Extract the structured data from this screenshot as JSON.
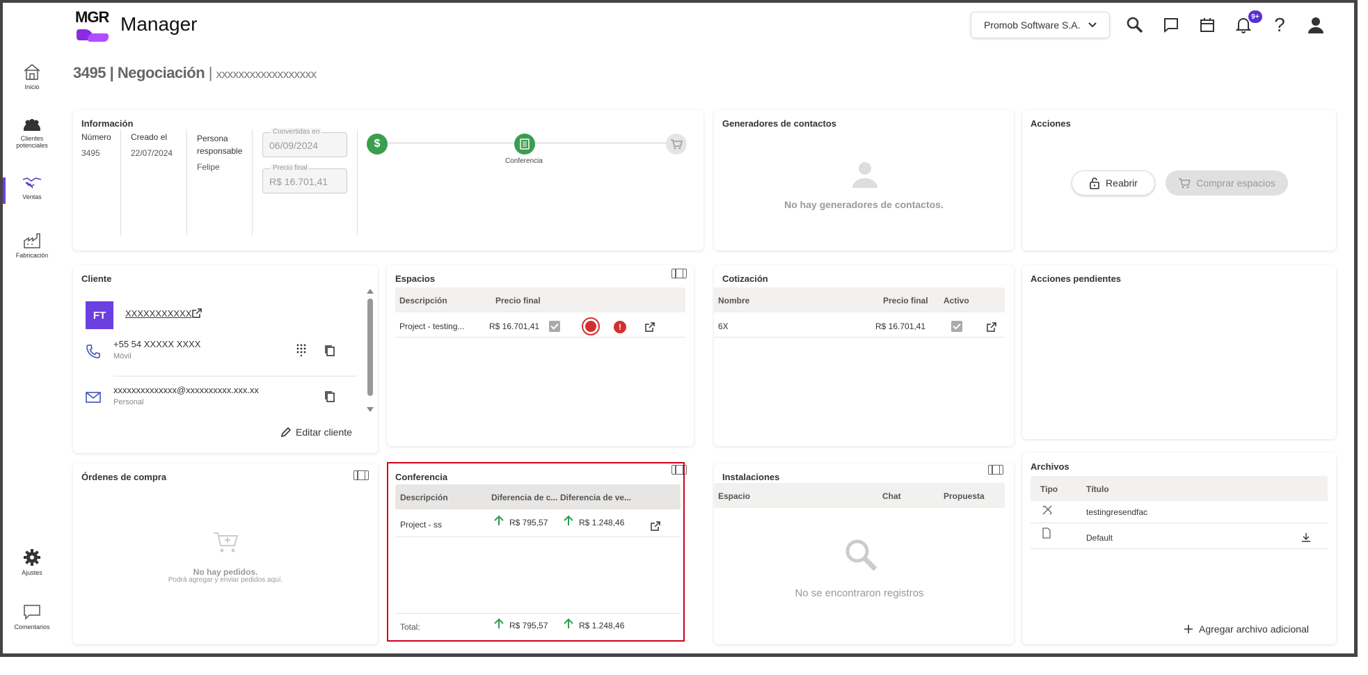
{
  "app": {
    "logo_text": "MGR",
    "title": "Manager"
  },
  "header": {
    "company": "Promob Software S.A.",
    "notifications_badge": "9+",
    "icons": [
      "search-icon",
      "chat-icon",
      "calendar-icon",
      "bell-icon",
      "help-icon",
      "user-icon"
    ]
  },
  "sidebar": {
    "items": [
      {
        "label": "Inicio",
        "icon": "home-icon"
      },
      {
        "label": "Clientes potenciales",
        "icon": "people-icon"
      },
      {
        "label": "Ventas",
        "icon": "handshake-icon",
        "active": true
      },
      {
        "label": "Fabricación",
        "icon": "factory-icon"
      },
      {
        "label": "Ajustes",
        "icon": "gear-icon"
      },
      {
        "label": "Comentarios",
        "icon": "comment-icon"
      }
    ]
  },
  "breadcrumb": {
    "number": "3495",
    "title": "Negociación",
    "client": "xxxxxxxxxxxxxxxxxx"
  },
  "info": {
    "title": "Información",
    "numero_label": "Número",
    "numero": "3495",
    "creado_label": "Creado el",
    "creado": "22/07/2024",
    "responsable_label": "Persona responsable",
    "responsable": "Felipe",
    "convertidas_label": "Convertidas en",
    "convertidas": "06/09/2024",
    "precio_label": "Precio final",
    "precio": "R$ 16.701,41",
    "stage_label": "Conferencia"
  },
  "generadores": {
    "title": "Generadores de contactos",
    "empty": "No hay generadores de contactos."
  },
  "acciones": {
    "title": "Acciones",
    "reabrir": "Reabrir",
    "comprar": "Comprar espacios"
  },
  "cliente": {
    "title": "Cliente",
    "initials": "FT",
    "name": "XXXXXXXXXXX",
    "phone": "+55 54 XXXXX XXXX",
    "phone_type": "Móvil",
    "email": "xxxxxxxxxxxxxx@xxxxxxxxxx.xxx.xx",
    "email_type": "Personal",
    "edit": "Editar cliente"
  },
  "espacios": {
    "title": "Espacios",
    "columns": [
      "Descripción",
      "Precio final"
    ],
    "rows": [
      {
        "descripcion": "Project - testing...",
        "precio": "R$ 16.701,41"
      }
    ]
  },
  "cotizacion": {
    "title": "Cotización",
    "columns": [
      "Nombre",
      "Precio final",
      "Activo"
    ],
    "rows": [
      {
        "nombre": "6X",
        "precio": "R$ 16.701,41"
      }
    ]
  },
  "pendientes": {
    "title": "Acciones pendientes"
  },
  "ordenes": {
    "title": "Órdenes de compra",
    "empty": "No hay pedidos.",
    "empty_sub": "Podrá agregar y enviar pedidos aquí."
  },
  "conferencia": {
    "title": "Conferencia",
    "columns": [
      "Descripción",
      "Diferencia de c...",
      "Diferencia de ve..."
    ],
    "rows": [
      {
        "descripcion": "Project - ss",
        "dif_c": "R$ 795,57",
        "dif_v": "R$ 1.248,46"
      }
    ],
    "total_label": "Total:",
    "total_c": "R$ 795,57",
    "total_v": "R$ 1.248,46"
  },
  "instalaciones": {
    "title": "Instalaciones",
    "columns": [
      "Espacio",
      "Chat",
      "Propuesta"
    ],
    "empty": "No se encontraron registros"
  },
  "archivos": {
    "title": "Archivos",
    "columns": [
      "Tipo",
      "Título"
    ],
    "rows": [
      {
        "titulo": "testingresendfac"
      },
      {
        "titulo": "Default"
      }
    ],
    "add": "Agregar archivo adicional"
  },
  "colors": {
    "accent": "#6c3fe0",
    "success": "#2e9e4f",
    "error": "#d32f2f",
    "highlight": "#d0021b"
  }
}
